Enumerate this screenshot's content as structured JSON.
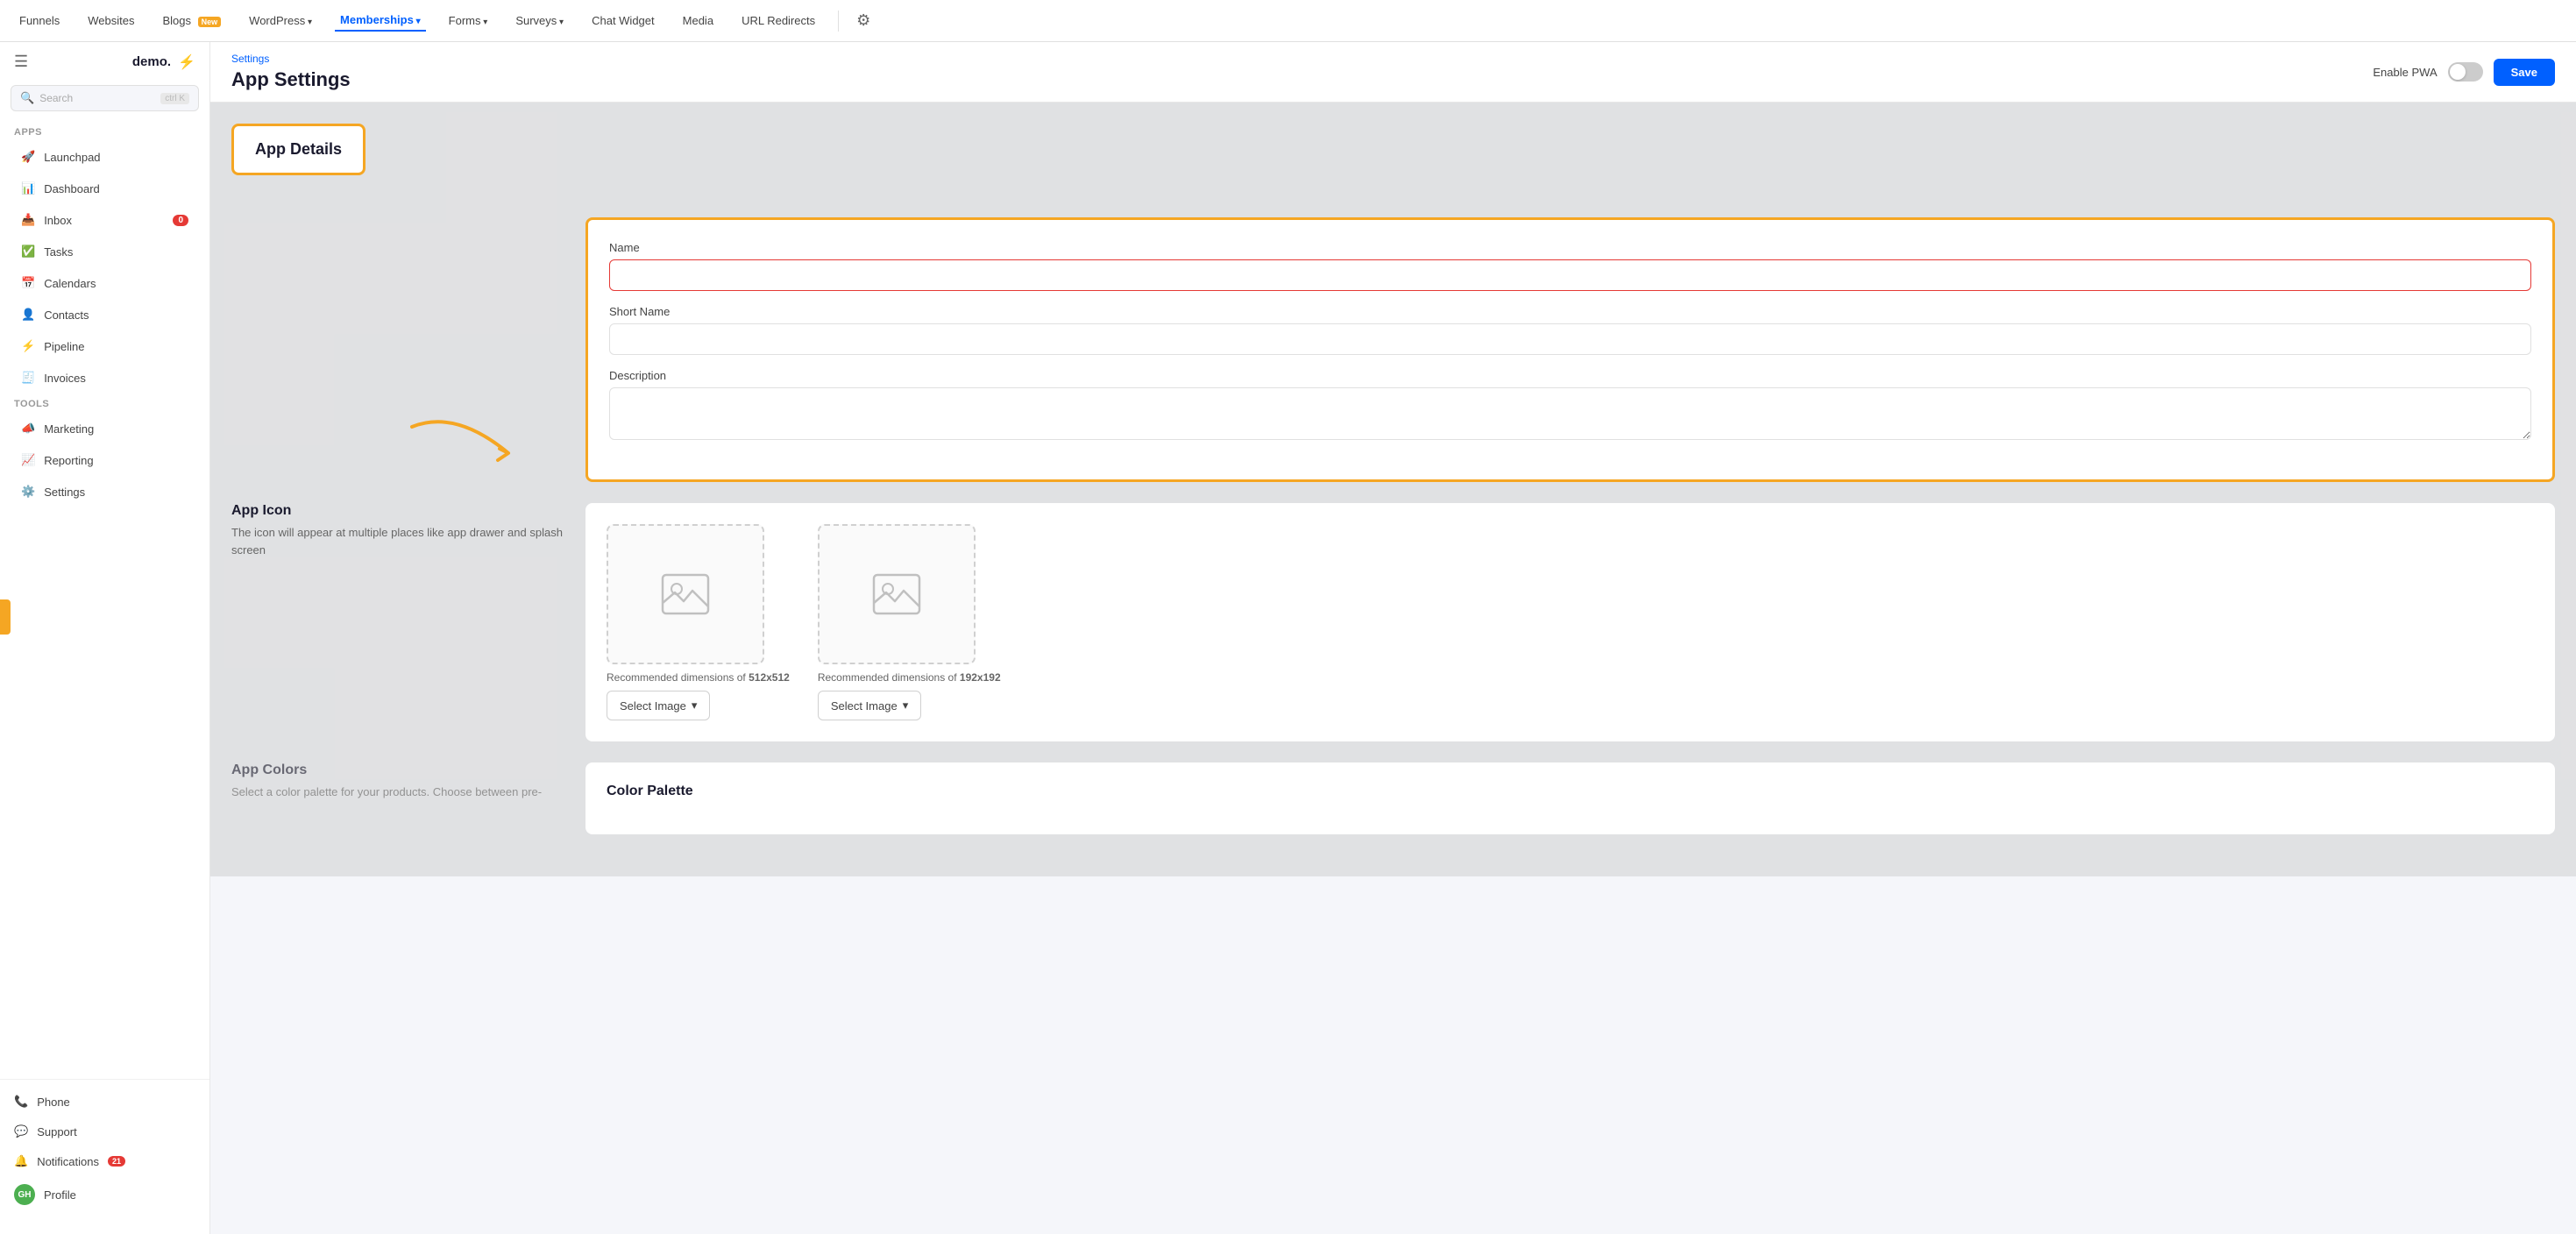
{
  "topNav": {
    "items": [
      {
        "label": "Funnels",
        "hasArrow": false,
        "active": false
      },
      {
        "label": "Websites",
        "hasArrow": false,
        "active": false
      },
      {
        "label": "Blogs",
        "hasArrow": false,
        "active": false,
        "badge": "New"
      },
      {
        "label": "WordPress",
        "hasArrow": true,
        "active": false
      },
      {
        "label": "Memberships",
        "hasArrow": true,
        "active": true
      },
      {
        "label": "Forms",
        "hasArrow": true,
        "active": false
      },
      {
        "label": "Surveys",
        "hasArrow": true,
        "active": false
      },
      {
        "label": "Chat Widget",
        "hasArrow": false,
        "active": false
      },
      {
        "label": "Media",
        "hasArrow": false,
        "active": false
      },
      {
        "label": "URL Redirects",
        "hasArrow": false,
        "active": false
      }
    ]
  },
  "sidebar": {
    "logo": "demo.",
    "searchPlaceholder": "Search",
    "searchShortcut": "ctrl K",
    "sectionApps": "Apps",
    "sectionTools": "Tools",
    "appsItems": [
      {
        "label": "Launchpad",
        "icon": "🚀"
      },
      {
        "label": "Dashboard",
        "icon": "📊"
      },
      {
        "label": "Inbox",
        "icon": "📥",
        "badge": "0"
      },
      {
        "label": "Tasks",
        "icon": "✅"
      },
      {
        "label": "Calendars",
        "icon": "📅"
      },
      {
        "label": "Contacts",
        "icon": "👤"
      },
      {
        "label": "Pipeline",
        "icon": "⚡"
      },
      {
        "label": "Invoices",
        "icon": "🧾"
      }
    ],
    "toolsItems": [
      {
        "label": "Marketing",
        "icon": "📣"
      },
      {
        "label": "Reporting",
        "icon": "📈"
      },
      {
        "label": "Settings",
        "icon": "⚙️"
      }
    ],
    "bottomItems": [
      {
        "label": "Phone",
        "icon": "📞"
      },
      {
        "label": "Support",
        "icon": "💬"
      },
      {
        "label": "Notifications",
        "icon": "🔔",
        "badge": "21"
      },
      {
        "label": "Profile",
        "icon": "👤",
        "isAvatar": true
      }
    ]
  },
  "pageHeader": {
    "breadcrumb": "Settings",
    "title": "App Settings",
    "enablePwaLabel": "Enable PWA",
    "saveLabel": "Save"
  },
  "appDetails": {
    "sectionTitle": "App Details",
    "fields": {
      "nameLabel": "Name",
      "namePlaceholder": "",
      "shortNameLabel": "Short Name",
      "shortNamePlaceholder": "",
      "descriptionLabel": "Description",
      "descriptionPlaceholder": ""
    }
  },
  "appIcon": {
    "sectionTitle": "App Icon",
    "sectionDesc": "The icon will appear at multiple places like app drawer and splash screen",
    "image1": {
      "dimText": "Recommended dimensions of ",
      "dimValue": "512x512",
      "buttonLabel": "Select Image"
    },
    "image2": {
      "dimText": "Recommended dimensions of ",
      "dimValue": "192x192",
      "buttonLabel": "Select Image"
    }
  },
  "appColors": {
    "sectionTitle": "App Colors",
    "sectionDesc": "Select a color palette for your products. Choose between pre-",
    "colorPaletteTitle": "Color Palette"
  }
}
